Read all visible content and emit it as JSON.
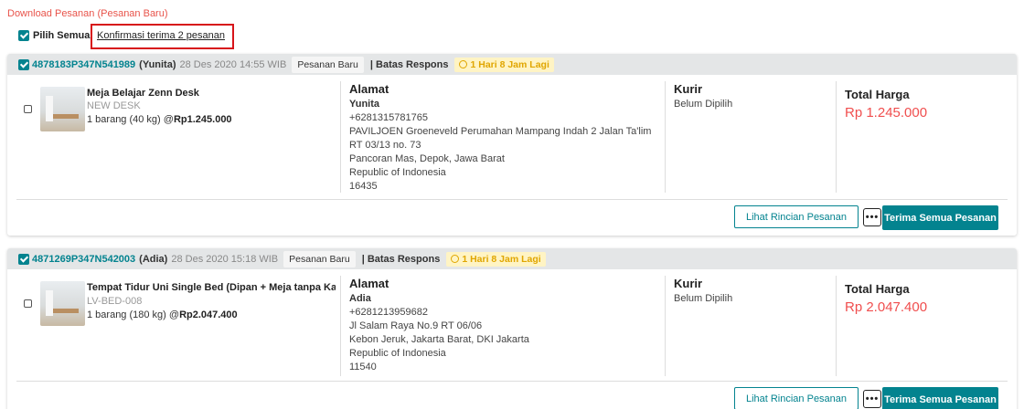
{
  "top_link": "Download Pesanan (Pesanan Baru)",
  "select_all_label": "Pilih Semua",
  "confirm_link": "Konfirmasi terima 2 pesanan",
  "labels": {
    "address": "Alamat",
    "courier": "Kurir",
    "total": "Total Harga",
    "deadline": "| Batas Respons",
    "detail_button": "Lihat Rincian Pesanan",
    "more_button": "•••",
    "accept_button": "Terima Semua Pesanan"
  },
  "orders": [
    {
      "id": "4878183P347N541989",
      "buyer": "(Yunita)",
      "date": "28 Des 2020 14:55 WIB",
      "status": "Pesanan Baru",
      "deadline": "1 Hari 8 Jam Lagi",
      "product": {
        "name": "Meja Belajar Zenn Desk",
        "sku": "NEW DESK",
        "qty_text": "1 barang (40 kg) @",
        "price": "Rp1.245.000"
      },
      "address": {
        "name": "Yunita",
        "lines": [
          "+6281315781765",
          "PAVILJOEN Groeneveld Perumahan Mampang Indah 2 Jalan Ta'lim",
          "RT 03/13 no. 73",
          "Pancoran Mas, Depok, Jawa Barat",
          "Republic of Indonesia",
          "16435"
        ]
      },
      "courier": "Belum Dipilih",
      "total": "Rp 1.245.000"
    },
    {
      "id": "4871269P347N542003",
      "buyer": "(Adia)",
      "date": "28 Des 2020 15:18 WIB",
      "status": "Pesanan Baru",
      "deadline": "1 Hari 8 Jam Lagi",
      "product": {
        "name": "Tempat Tidur Uni Single Bed (Dipan + Meja tanpa Ka",
        "sku": "LV-BED-008",
        "qty_text": "1 barang (180 kg) @",
        "price": "Rp2.047.400"
      },
      "address": {
        "name": "Adia",
        "lines": [
          "+6281213959682",
          "Jl Salam Raya No.9 RT 06/06",
          "Kebon Jeruk, Jakarta Barat, DKI Jakarta",
          "Republic of Indonesia",
          "11540"
        ]
      },
      "courier": "Belum Dipilih",
      "total": "Rp 2.047.400"
    }
  ]
}
